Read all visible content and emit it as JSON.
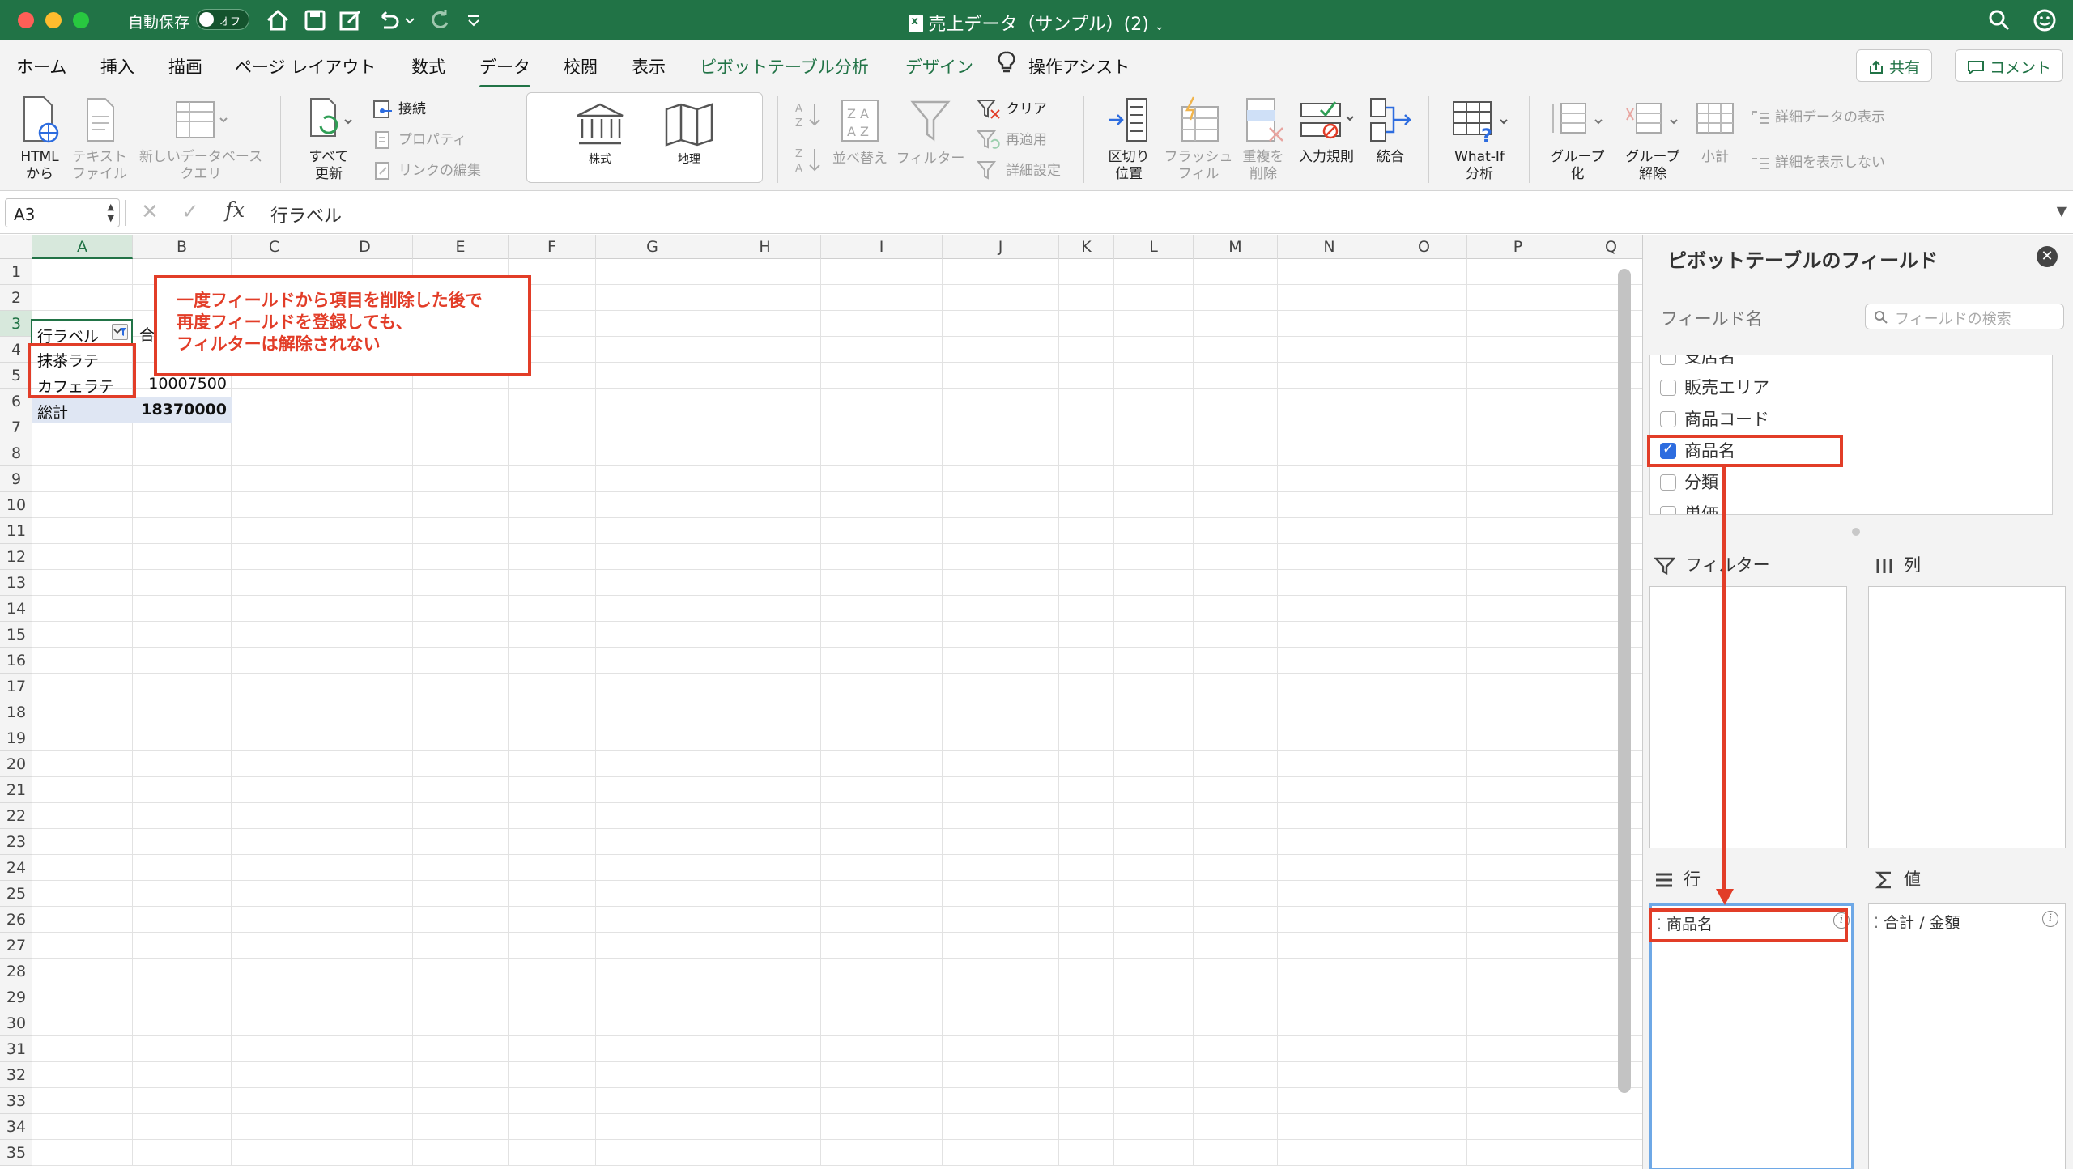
{
  "titlebar": {
    "autosave_label": "自動保存",
    "autosave_state": "オフ",
    "document_title": "売上データ（サンプル）(2)"
  },
  "tabs": [
    {
      "label": "ホーム"
    },
    {
      "label": "挿入"
    },
    {
      "label": "描画"
    },
    {
      "label": "ページ レイアウト"
    },
    {
      "label": "数式"
    },
    {
      "label": "データ"
    },
    {
      "label": "校閲"
    },
    {
      "label": "表示"
    },
    {
      "label": "ピボットテーブル分析"
    },
    {
      "label": "デザイン"
    },
    {
      "label": "操作アシスト"
    }
  ],
  "header_buttons": {
    "share": "共有",
    "comment": "コメント"
  },
  "ribbon": {
    "html_line1": "HTML",
    "html_line2": "から",
    "text_line1": "テキスト",
    "text_line2": "ファイル",
    "newquery_line1": "新しいデータベース",
    "newquery_line2": "クエリ",
    "refresh_line1": "すべて",
    "refresh_line2": "更新",
    "connections": "接続",
    "properties": "プロパティ",
    "edit_links": "リンクの編集",
    "stocks": "株式",
    "geography": "地理",
    "sort": "並べ替え",
    "filter": "フィルター",
    "clear": "クリア",
    "reapply": "再適用",
    "advanced": "詳細設定",
    "text_to_columns_line1": "区切り",
    "text_to_columns_line2": "位置",
    "flash_fill_line1": "フラッシュ",
    "flash_fill_line2": "フィル",
    "remove_dup_line1": "重複を",
    "remove_dup_line2": "削除",
    "validation": "入力規則",
    "consolidate": "統合",
    "whatif_line1": "What-If",
    "whatif_line2": "分析",
    "group_line1": "グループ",
    "group_line2": "化",
    "ungroup_line1": "グループ",
    "ungroup_line2": "解除",
    "subtotal": "小計",
    "show_detail": "詳細データの表示",
    "hide_detail": "詳細を表示しない"
  },
  "formula_bar": {
    "name_box": "A3",
    "fx": "fx",
    "formula": "行ラベル"
  },
  "columns": [
    "A",
    "B",
    "C",
    "D",
    "E",
    "F",
    "G",
    "H",
    "I",
    "J",
    "K",
    "L",
    "M",
    "N",
    "O",
    "P",
    "Q"
  ],
  "rows": [
    "1",
    "2",
    "3",
    "4",
    "5",
    "6",
    "7",
    "8",
    "9",
    "10",
    "11",
    "12",
    "13",
    "14",
    "15",
    "16",
    "17",
    "18",
    "19",
    "20",
    "21",
    "22",
    "23",
    "24",
    "25",
    "26",
    "27",
    "28",
    "29",
    "30",
    "31",
    "32",
    "33",
    "34",
    "35"
  ],
  "pivot_table": {
    "row_label_header": "行ラベル",
    "value_header_partial": "合",
    "items": [
      {
        "label": "抹茶ラテ",
        "value": ""
      },
      {
        "label": "カフェラテ",
        "value": "10007500"
      }
    ],
    "total_label": "総計",
    "total_value": "18370000"
  },
  "annotation": {
    "line1": "一度フィールドから項目を削除した後で",
    "line2": "再度フィールドを登録しても、",
    "line3": "フィルターは解除されない",
    "color": "#e23d28"
  },
  "pivot_pane": {
    "title": "ピボットテーブルのフィールド",
    "field_name_label": "フィールド名",
    "search_placeholder": "フィールドの検索",
    "fields": [
      {
        "label": "支店名",
        "checked": false
      },
      {
        "label": "販売エリア",
        "checked": false
      },
      {
        "label": "商品コード",
        "checked": false
      },
      {
        "label": "商品名",
        "checked": true
      },
      {
        "label": "分類",
        "checked": false
      },
      {
        "label": "単価",
        "checked": false
      }
    ],
    "areas": {
      "filter": "フィルター",
      "columns": "列",
      "rows": "行",
      "values": "値"
    },
    "rows_item": "商品名",
    "values_item": "合計 / 金額"
  },
  "colors": {
    "accent": "#217346",
    "annotation": "#e23d28",
    "checkbox": "#2d6cdf"
  }
}
